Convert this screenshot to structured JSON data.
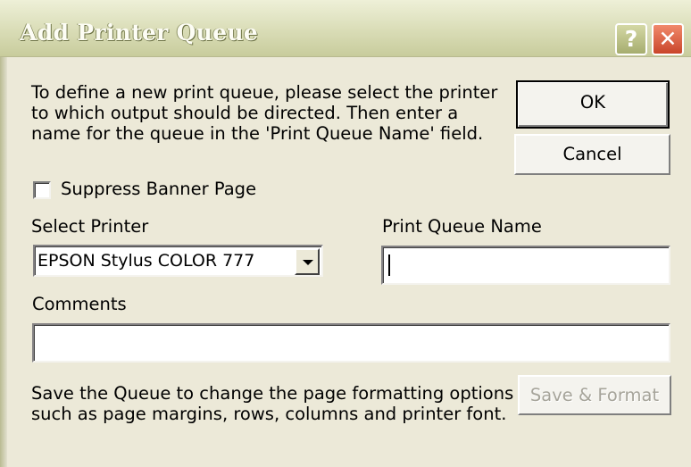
{
  "window": {
    "title": "Add Printer Queue",
    "help_glyph": "?",
    "close_glyph": "✕"
  },
  "intro": {
    "line1": "To define a new print queue, please select the printer",
    "line2": "to which output should be directed.  Then enter a",
    "line3": "name for the queue in the 'Print Queue Name' field."
  },
  "buttons": {
    "ok": "OK",
    "cancel": "Cancel",
    "save_format": "Save & Format"
  },
  "suppress_banner": {
    "label": "Suppress Banner Page",
    "checked": false
  },
  "select_printer": {
    "label": "Select Printer",
    "value": "EPSON Stylus COLOR 777"
  },
  "queue_name": {
    "label": "Print Queue Name",
    "value": ""
  },
  "comments": {
    "label": "Comments",
    "value": ""
  },
  "footer": {
    "line1": "Save the Queue to change the page formatting options",
    "line2": "such as page margins, rows, columns and printer font."
  }
}
